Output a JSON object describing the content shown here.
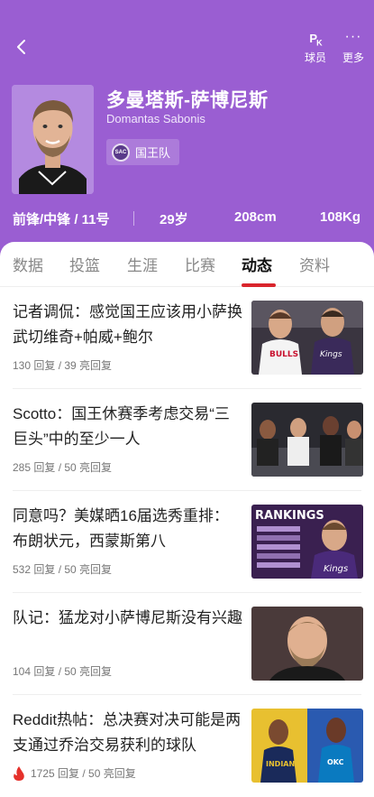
{
  "header": {
    "player_name_cn": "多曼塔斯-萨博尼斯",
    "player_name_en": "Domantas Sabonis",
    "team_name": "国王队",
    "pk_label": "球员",
    "more_label": "更多",
    "stats": {
      "position": "前锋/中锋 / 11号",
      "age": "29岁",
      "height": "208cm",
      "weight": "108Kg"
    },
    "colors": {
      "accent": "#9a5ed2",
      "tab_indicator": "#d9252c"
    }
  },
  "tabs": [
    {
      "label": "数据"
    },
    {
      "label": "投篮"
    },
    {
      "label": "生涯"
    },
    {
      "label": "比赛"
    },
    {
      "label": "动态"
    },
    {
      "label": "资料"
    }
  ],
  "active_tab": "动态",
  "news": [
    {
      "title": "记者调侃：感觉国王应该用小萨换武切维奇+帕威+鲍尔",
      "meta": "130 回复 / 39 亮回复",
      "hot": false,
      "thumb": "two-players-bulls-kings-icon"
    },
    {
      "title": "Scotto：国王休赛季考虑交易“三巨头”中的至少一人",
      "meta": "285 回复 / 50 亮回复",
      "hot": false,
      "thumb": "kings-bench-icon"
    },
    {
      "title": "同意吗？美媒晒16届选秀重排：布朗状元，西蒙斯第八",
      "meta": "532 回复 / 50 亮回复",
      "hot": false,
      "thumb": "rankings-graphic-icon"
    },
    {
      "title": "队记：猛龙对小萨博尼斯没有兴趣",
      "meta": "104 回复 / 50 亮回复",
      "hot": false,
      "thumb": "player-portrait-icon"
    },
    {
      "title": "Reddit热帖：总决赛对决可能是两支通过乔治交易获利的球队",
      "meta": "1725 回复 / 50 亮回复",
      "hot": true,
      "thumb": "pacers-thunder-players-icon"
    }
  ]
}
